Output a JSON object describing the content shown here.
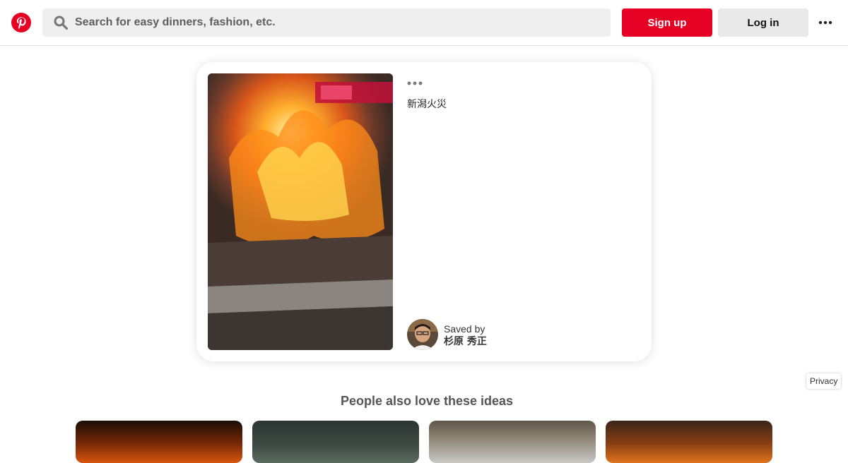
{
  "header": {
    "logo_icon": "pinterest-logo-icon",
    "search": {
      "icon": "search-icon",
      "placeholder": "Search for easy dinners, fashion, etc.",
      "value": ""
    },
    "signup_label": "Sign up",
    "login_label": "Log in",
    "more_icon": "more-horizontal-icon"
  },
  "pin": {
    "image_alt": "fire photo",
    "more_icon": "more-horizontal-icon",
    "title": "新潟火災",
    "saved_by_label": "Saved by",
    "saver_name": "杉原 秀正"
  },
  "privacy_label": "Privacy",
  "related": {
    "title": "People also love these ideas",
    "thumbnails": [
      "fire-photo",
      "night-scene-photo",
      "building-photo",
      "fire-photo"
    ]
  },
  "colors": {
    "brand_red": "#e60023",
    "login_button_bg": "#e9e9e9",
    "search_bg": "#efefef"
  }
}
